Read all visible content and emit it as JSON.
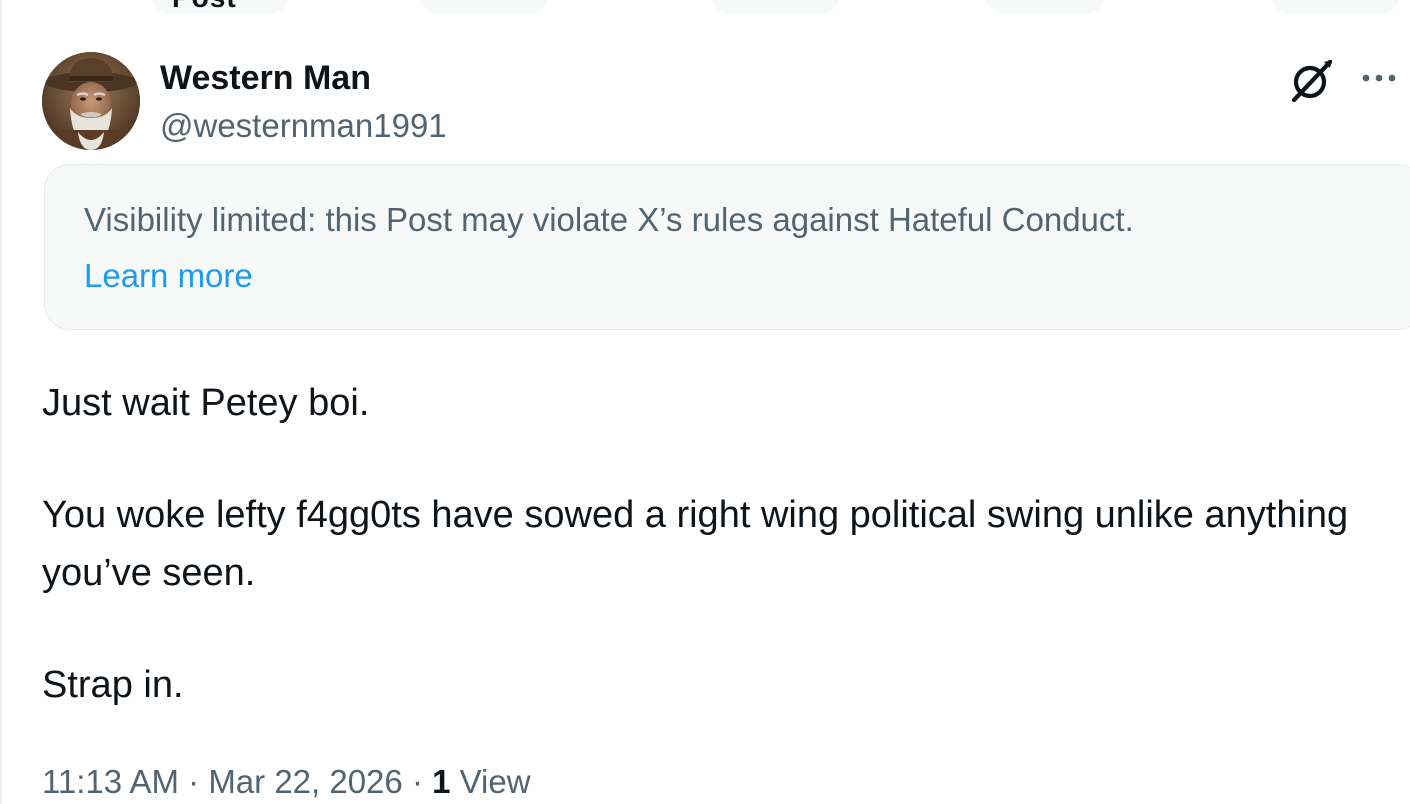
{
  "header": {
    "title_fragment": "Post"
  },
  "post": {
    "author": {
      "display_name": "Western Man",
      "handle": "@westernman1991",
      "avatar": "avatar-image-old-man-cowboy-hat"
    },
    "actions": {
      "grok_icon": "grok-icon",
      "more_icon": "more-icon"
    },
    "notice": {
      "text": "Visibility limited: this Post may violate X’s rules against Hateful Conduct.",
      "link_label": "Learn more"
    },
    "body": {
      "paragraphs": [
        "Just wait Petey boi.",
        "You woke lefty f4gg0ts have sowed a right wing political swing unlike anything you’ve seen.",
        "Strap in."
      ]
    },
    "meta": {
      "time": "11:13 AM",
      "separator": " · ",
      "date": "Mar 22, 2026",
      "views_count": "1",
      "views_label": " View"
    }
  },
  "colors": {
    "text_primary": "#0f1419",
    "text_secondary": "#536471",
    "link": "#1d9bf0",
    "notice_bg": "#f7f9f9",
    "border": "#e6ecf0"
  }
}
